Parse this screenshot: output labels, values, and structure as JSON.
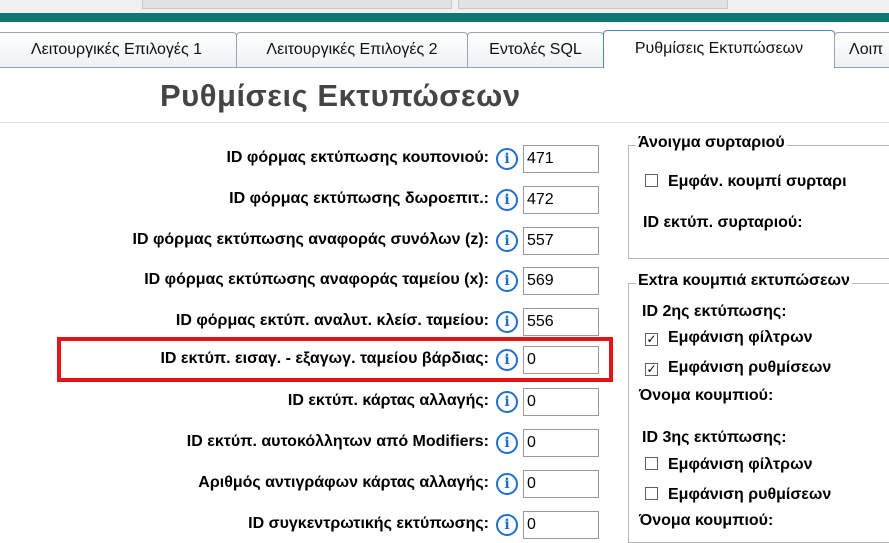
{
  "tabs": [
    {
      "label": "Λειτουργικές Επιλογές 1"
    },
    {
      "label": "Λειτουργικές Επιλογές 2"
    },
    {
      "label": "Εντολές SQL"
    },
    {
      "label": "Ρυθμίσεις Εκτυπώσεων"
    },
    {
      "label": "Λοιπ"
    }
  ],
  "active_tab": "Ρυθμίσεις Εκτυπώσεων",
  "page_title": "Ρυθμίσεις Εκτυπώσεων",
  "info_icon_glyph": "i",
  "form_rows": [
    {
      "label": "ID φόρμας εκτύπωσης κουπονιού:",
      "value": "471"
    },
    {
      "label": "ID φόρμας εκτύπωσης δωροεπιτ.:",
      "value": "472"
    },
    {
      "label": "ID φόρμας εκτύπωσης αναφοράς συνόλων (z):",
      "value": "557"
    },
    {
      "label": "ID φόρμας εκτύπωσης αναφοράς ταμείου (x):",
      "value": "569"
    },
    {
      "label": "ID φόρμας εκτύπ. αναλυτ. κλείσ. ταμείου:",
      "value": "556"
    },
    {
      "label": "ID εκτύπ. εισαγ. - εξαγωγ. ταμείου βάρδιας:",
      "value": "0"
    },
    {
      "label": "ID εκτύπ. κάρτας αλλαγής:",
      "value": "0"
    },
    {
      "label": "ID εκτύπ. αυτοκόλλητων από Modifiers:",
      "value": "0"
    },
    {
      "label": "Αριθμός αντιγράφων κάρτας αλλαγής:",
      "value": "0"
    },
    {
      "label": "ID συγκεντρωτικής εκτύπωσης:",
      "value": "0"
    }
  ],
  "drawer_group": {
    "title": "Άνοιγμα συρταριού",
    "checkbox_label": "Εμφάν. κουμπί συρταρι",
    "checkbox_checked": false,
    "id_label": "ID εκτύπ. συρταριού:"
  },
  "extra_group": {
    "title": "Extra κουμπιά εκτυπώσεων",
    "second": {
      "id_label": "ID 2ης εκτύπωσης:",
      "filters_label": "Εμφάνιση φίλτρων",
      "filters_checked": true,
      "settings_label": "Εμφάνιση ρυθμίσεων",
      "settings_checked": true,
      "button_name_label": "Όνομα κουμπιού:"
    },
    "third": {
      "id_label": "ID 3ης εκτύπωσης:",
      "filters_label": "Εμφάνιση φίλτρων",
      "filters_checked": false,
      "settings_label": "Εμφάνιση ρυθμίσεων",
      "settings_checked": false,
      "button_name_label": "Όνομα κουμπιού:"
    }
  },
  "colors": {
    "accent_teal": "#0d7872",
    "info_blue": "#1f6fd1",
    "highlight_red": "#e5141a",
    "title_gray": "#454545"
  }
}
